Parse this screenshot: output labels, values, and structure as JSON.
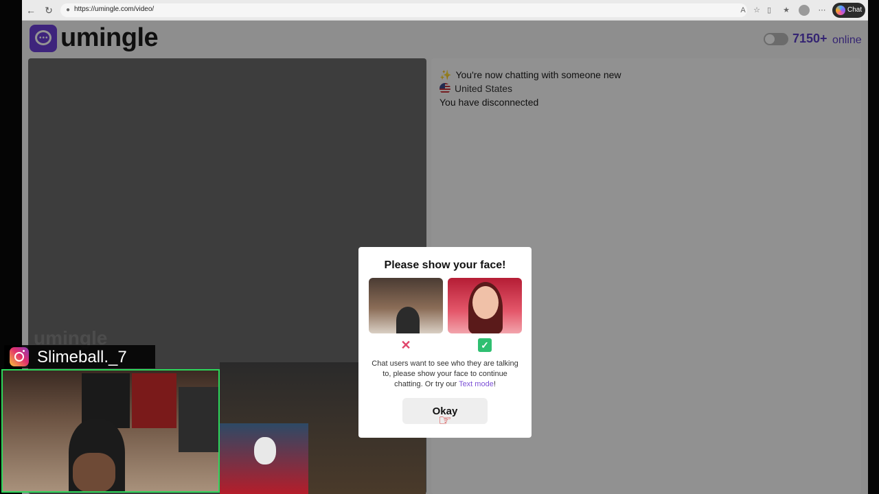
{
  "browser": {
    "url": "https://umingle.com/video/",
    "chat_button_label": "Chat",
    "colors": {
      "toolbar": "#eaeaea",
      "chat_button": "#2b2b2b"
    }
  },
  "site": {
    "logo_text": "umingle",
    "online_count": "7150+",
    "online_label": "online",
    "video_watermark": "umingle",
    "colors": {
      "brand": "#6b3fd6",
      "online_text": "#5b3fc4"
    }
  },
  "chat": {
    "messages": [
      {
        "icon": "sparkle-icon",
        "text": "You're now chatting with someone new"
      },
      {
        "icon": "us-flag-icon",
        "text": "United States"
      },
      {
        "text": "You have disconnected"
      }
    ]
  },
  "modal": {
    "title": "Please show your face!",
    "body_before_link": "Chat users want to see who they are talking to, please show your face to continue chatting. Or try our ",
    "link_text": "Text mode",
    "body_after_link": "!",
    "okay_label": "Okay",
    "colors": {
      "reject": "#e0456b",
      "approve": "#2fbf71",
      "link": "#7b4fd6"
    }
  },
  "overlay": {
    "instagram_handle": "Slimeball._7",
    "colors": {
      "webcam_border": "#2cd85b"
    }
  }
}
